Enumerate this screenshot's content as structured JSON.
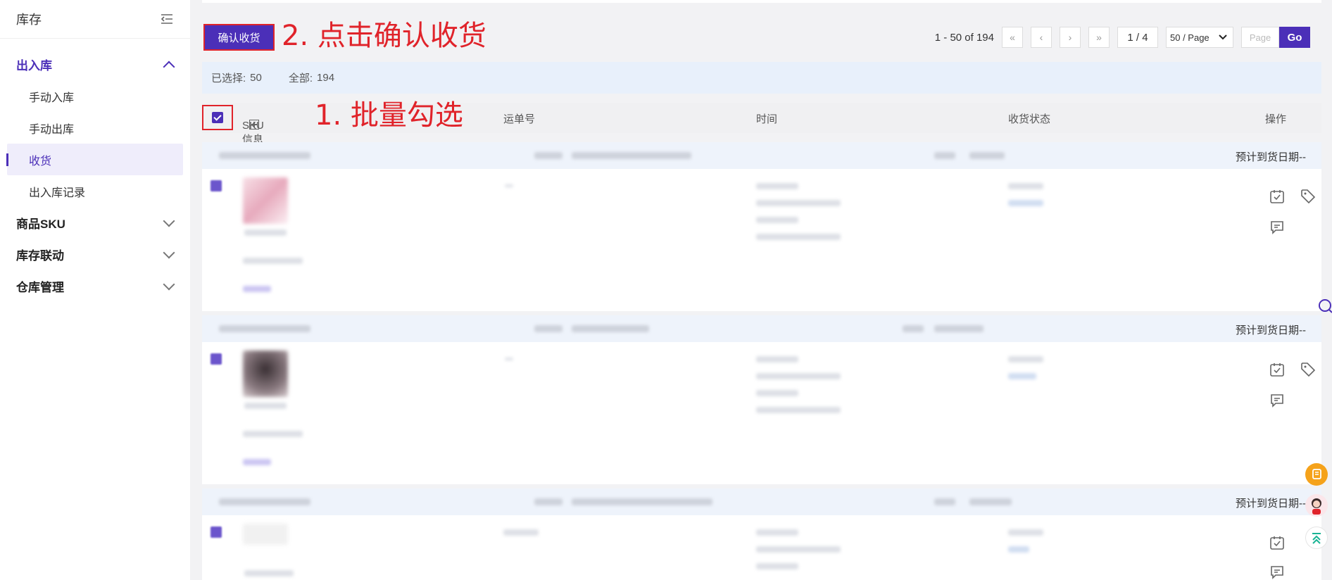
{
  "sidebar": {
    "title": "库存",
    "groups": [
      {
        "label": "出入库",
        "items": [
          "手动入库",
          "手动出库",
          "收货",
          "出入库记录"
        ]
      },
      {
        "label": "商品SKU"
      },
      {
        "label": "库存联动"
      },
      {
        "label": "仓库管理"
      }
    ]
  },
  "toolbar": {
    "confirm_label": "确认收货"
  },
  "annotations": {
    "step1": "1. 批量勾选",
    "step2": "2. 点击确认收货"
  },
  "pager": {
    "range": "1 - 50 of 194",
    "current": "1 / 4",
    "page_size": "50 / Page",
    "page_placeholder": "Page",
    "go": "Go",
    "first": "«",
    "prev": "‹",
    "next": "›",
    "last": "»"
  },
  "selection": {
    "selected_label": "已选择:",
    "selected_count": "50",
    "total_label": "全部:",
    "total_count": "194"
  },
  "table": {
    "headers": {
      "sku": "SKU信息",
      "tracking": "运单号",
      "time": "时间",
      "status": "收货状态",
      "actions": "操作"
    }
  },
  "orders": [
    {
      "eta": "预计到货日期--"
    },
    {
      "eta": "预计到货日期--"
    },
    {
      "eta": "预计到货日期--"
    }
  ],
  "colors": {
    "accent": "#4b2fb8",
    "annotation": "#e0232a",
    "selection_bar": "#e8f0fb"
  }
}
